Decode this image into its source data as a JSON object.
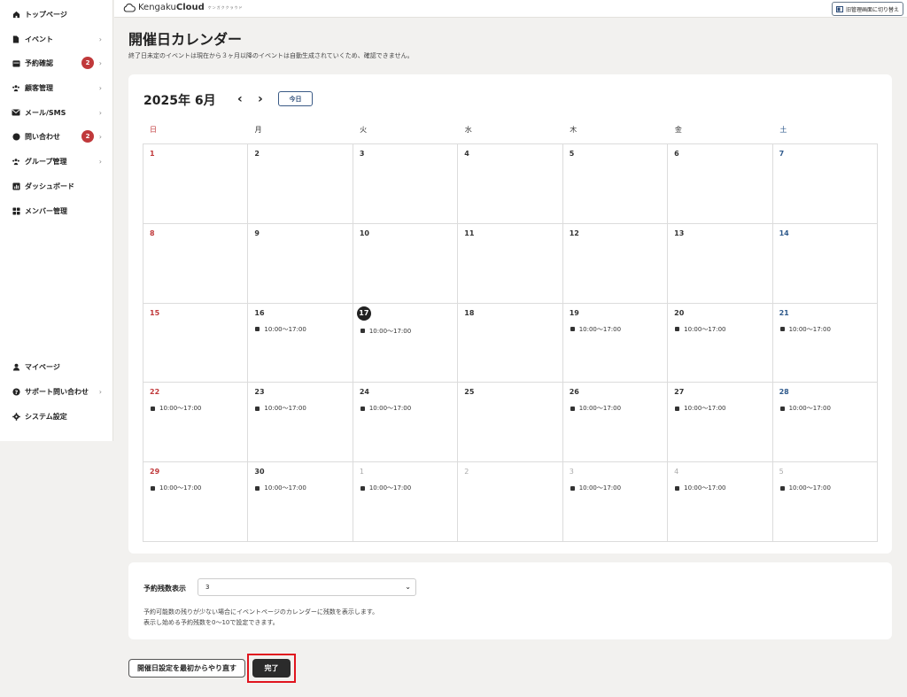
{
  "sidebar": {
    "items": [
      {
        "label": "トップページ",
        "icon": "home-icon",
        "chevron": false
      },
      {
        "label": "イベント",
        "icon": "document-icon",
        "chevron": true
      },
      {
        "label": "予約確認",
        "icon": "calendar-icon",
        "chevron": true,
        "badge": "2"
      },
      {
        "label": "顧客管理",
        "icon": "users-icon",
        "chevron": true
      },
      {
        "label": "メール/SMS",
        "icon": "mail-icon",
        "chevron": true
      },
      {
        "label": "問い合わせ",
        "icon": "chat-icon",
        "chevron": true,
        "badge": "2"
      },
      {
        "label": "グループ管理",
        "icon": "group-icon",
        "chevron": true
      },
      {
        "label": "ダッシュボード",
        "icon": "chart-icon",
        "chevron": false
      },
      {
        "label": "メンバー管理",
        "icon": "grid-icon",
        "chevron": false
      }
    ],
    "bottom_items": [
      {
        "label": "マイページ",
        "icon": "person-icon",
        "chevron": false
      },
      {
        "label": "サポート問い合わせ",
        "icon": "help-icon",
        "chevron": true
      },
      {
        "label": "システム設定",
        "icon": "gear-icon",
        "chevron": false
      }
    ]
  },
  "header": {
    "logo_prefix": "Kengaku",
    "logo_bold": "Cloud",
    "logo_sub": "ケンガククラウド",
    "switch_label": "旧管理画面に切り替え"
  },
  "page": {
    "title": "開催日カレンダー",
    "description": "終了日未定のイベントは現在から３ヶ月以降のイベントは自動生成されていくため、確認できません。"
  },
  "calendar": {
    "month_label": "2025年 6月",
    "prev": "‹",
    "next": "›",
    "today_label": "今日",
    "weekdays": [
      "日",
      "月",
      "火",
      "水",
      "木",
      "金",
      "土"
    ],
    "weeks": [
      [
        {
          "d": "1"
        },
        {
          "d": "2"
        },
        {
          "d": "3"
        },
        {
          "d": "4"
        },
        {
          "d": "5"
        },
        {
          "d": "6"
        },
        {
          "d": "7"
        }
      ],
      [
        {
          "d": "8"
        },
        {
          "d": "9"
        },
        {
          "d": "10"
        },
        {
          "d": "11"
        },
        {
          "d": "12"
        },
        {
          "d": "13"
        },
        {
          "d": "14"
        }
      ],
      [
        {
          "d": "15"
        },
        {
          "d": "16",
          "ev": "10:00〜17:00"
        },
        {
          "d": "17",
          "ev": "10:00〜17:00",
          "today": true
        },
        {
          "d": "18"
        },
        {
          "d": "19",
          "ev": "10:00〜17:00"
        },
        {
          "d": "20",
          "ev": "10:00〜17:00"
        },
        {
          "d": "21",
          "ev": "10:00〜17:00"
        }
      ],
      [
        {
          "d": "22",
          "ev": "10:00〜17:00"
        },
        {
          "d": "23",
          "ev": "10:00〜17:00"
        },
        {
          "d": "24",
          "ev": "10:00〜17:00"
        },
        {
          "d": "25"
        },
        {
          "d": "26",
          "ev": "10:00〜17:00"
        },
        {
          "d": "27",
          "ev": "10:00〜17:00"
        },
        {
          "d": "28",
          "ev": "10:00〜17:00"
        }
      ],
      [
        {
          "d": "29",
          "ev": "10:00〜17:00"
        },
        {
          "d": "30",
          "ev": "10:00〜17:00"
        },
        {
          "d": "1",
          "ev": "10:00〜17:00",
          "other": true
        },
        {
          "d": "2",
          "other": true
        },
        {
          "d": "3",
          "ev": "10:00〜17:00",
          "other": true
        },
        {
          "d": "4",
          "ev": "10:00〜17:00",
          "other": true
        },
        {
          "d": "5",
          "ev": "10:00〜17:00",
          "other": true
        }
      ]
    ]
  },
  "remaining": {
    "label": "予約残数表示",
    "value": "3",
    "help_line1": "予約可能数の残りが少ない場合にイベントページのカレンダーに残数を表示します。",
    "help_line2": "表示し始める予約残数を0〜10で設定できます。"
  },
  "actions": {
    "reset_label": "開催日設定を最初からやり直す",
    "done_label": "完了"
  }
}
